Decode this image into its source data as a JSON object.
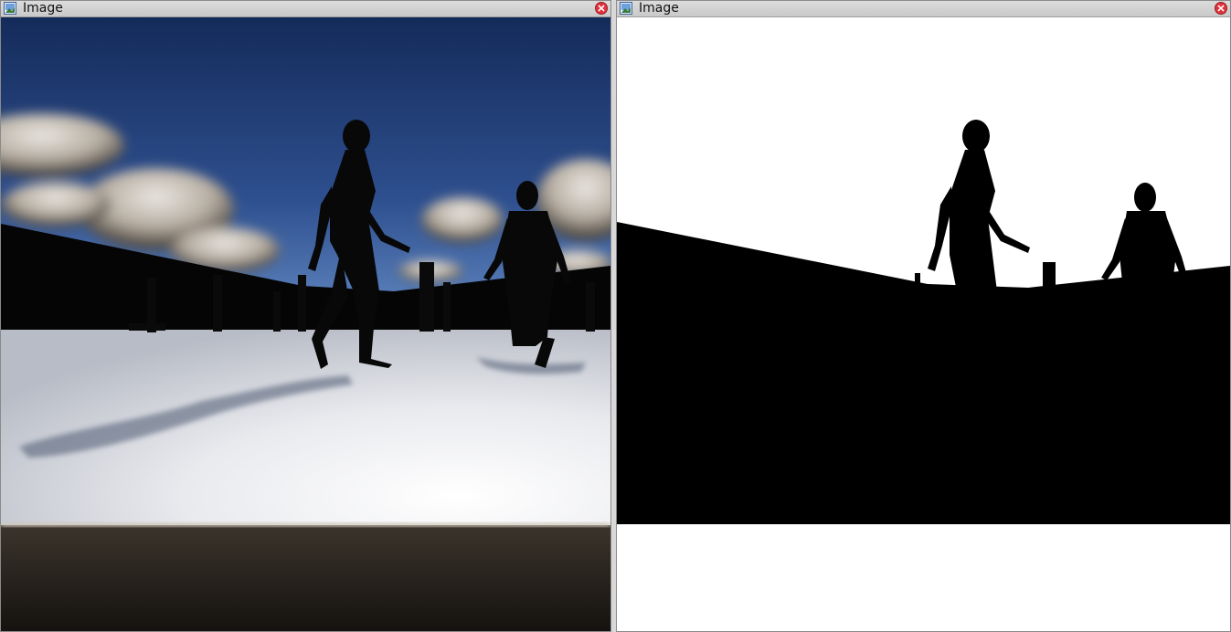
{
  "windows": [
    {
      "title": "Image",
      "content": "rendered-scene"
    },
    {
      "title": "Image",
      "content": "binary-mask"
    }
  ],
  "colors": {
    "sky_top": "#1c3567",
    "sky_bottom": "#5f89c4",
    "floor_light": "#f2f3f5",
    "silhouette": "#080808",
    "mask_white": "#ffffff",
    "mask_black": "#000000",
    "close_button": "#e0323c",
    "titlebar": "#d0d0d0"
  }
}
